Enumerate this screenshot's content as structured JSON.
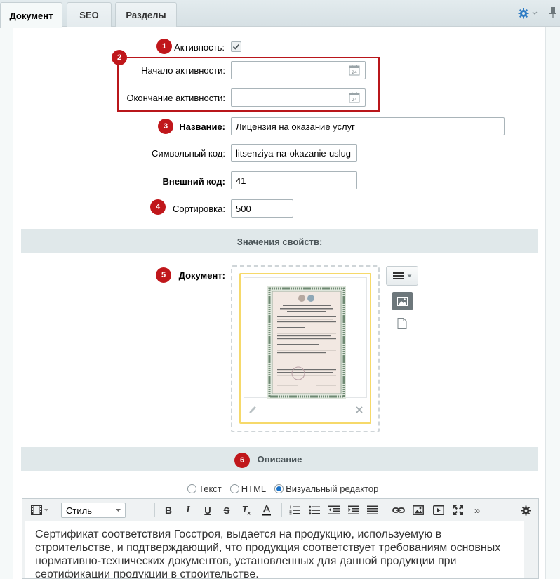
{
  "tabs": [
    {
      "label": "Документ",
      "active": true
    },
    {
      "label": "SEO",
      "active": false
    },
    {
      "label": "Разделы",
      "active": false
    }
  ],
  "header_icons": {
    "settings": "gear-icon",
    "pin": "pin-icon"
  },
  "badges": [
    "1",
    "2",
    "3",
    "4",
    "5",
    "6"
  ],
  "form": {
    "active_label": "Активность:",
    "active_checked": true,
    "start_label": "Начало активности:",
    "start_value": "",
    "end_label": "Окончание активности:",
    "end_value": "",
    "calendar_day": "24",
    "name_label": "Название:",
    "name_value": "Лицензия на оказание услуг",
    "code_label": "Символьный код:",
    "code_value": "litsenziya-na-okazanie-uslug",
    "ext_label": "Внешний код:",
    "ext_value": "41",
    "sort_label": "Сортировка:",
    "sort_value": "500"
  },
  "properties": {
    "header": "Значения свойств:",
    "document_label": "Документ:"
  },
  "description": {
    "header": "Описание",
    "modes": [
      {
        "label": "Текст",
        "checked": false
      },
      {
        "label": "HTML",
        "checked": false
      },
      {
        "label": "Визуальный редактор",
        "checked": true
      }
    ],
    "style_select": "Стиль",
    "content": "Сертификат соответствия Госстроя, выдается на продукцию, используемую в строительстве, и подтверждающий, что продукция соответствует требованиям основных нормативно-технических документов, установленных для данной продукции при сертификации продукции в строительстве."
  },
  "colors": {
    "badge": "#c0171b",
    "highlight_border": "#b9161b",
    "file_card_border": "#f6d96a",
    "accent_blue": "#1a73c9"
  }
}
